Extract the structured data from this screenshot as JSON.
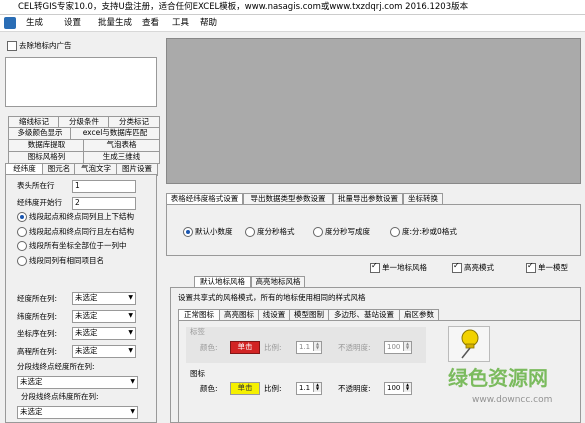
{
  "title": "CEL转GIS专家10.0，支持U盘注册，适合任何EXCEL模板，www.nasagis.com或www.txzdqrj.com 2016.1203版本",
  "menu": [
    "生成",
    "设置",
    "批量生成",
    "查看",
    "工具",
    "帮助"
  ],
  "remove_ads": "去除地标内广告",
  "left_tabs_row1": [
    "缩线标记",
    "分级条件",
    "分类标记"
  ],
  "left_tabs_row2": [
    "多级颜色显示",
    "excel与数据库匹配"
  ],
  "left_tabs_row3": [
    "数据库提取",
    "气泡表格"
  ],
  "left_tabs_row4": [
    "图标风格列",
    "生成三维线"
  ],
  "left_tabs_row5": [
    "经纬度",
    "图元名",
    "气泡文字",
    "图片设置"
  ],
  "header_row_label": "表头所在行",
  "header_row_value": "1",
  "start_row_label": "经纬度开始行",
  "start_row_value": "2",
  "structure_options": [
    "线段起点和终点同列且上下结构",
    "线段起点和终点同行且左右结构",
    "线段所有坐标全部位于一列中",
    "线段同列有相同项目名"
  ],
  "structure_selected": 0,
  "column_fields": [
    {
      "label": "经度所在列:",
      "value": "未选定"
    },
    {
      "label": "纬度所在列:",
      "value": "未选定"
    },
    {
      "label": "坐标序在列:",
      "value": "未选定"
    },
    {
      "label": "高程所在列:",
      "value": "未选定"
    }
  ],
  "segment_lon_label": "分段线终点经度所在列:",
  "segment_lon_value": "未选定",
  "segment_lat_label": "分段线终点纬度所在列:",
  "segment_lat_value": "未选定",
  "format_tabs": [
    "表格经纬度格式设置",
    "导出数据类型参数设置",
    "批量导出参数设置",
    "坐标转换"
  ],
  "format_options": [
    "默认小数度",
    "度分秒格式",
    "度分秒写成度",
    "度:分:秒或0格式"
  ],
  "format_selected": 0,
  "checkbox_single_style": "单一地标风格",
  "checkbox_high_mode": "高亮模式",
  "checkbox_single_model": "单一模型",
  "style_tabs": [
    "默认地标风格",
    "高亮地标风格"
  ],
  "style_description": "设置共享式的风格模式，所有的地标使用相同的样式风格",
  "inner_tabs": [
    "正常图标",
    "高亮图标",
    "线设置",
    "模型图制",
    "多边形、基站设置",
    "扇区参数"
  ],
  "label_group": "标签",
  "icon_group": "图标",
  "color_label": "颜色:",
  "scale_label": "比例:",
  "opacity_label": "不透明度:",
  "color_button": "单击",
  "scale_value": "1.1",
  "opacity_value": "100",
  "watermark_cn": "绿色资源网",
  "watermark_url": "www.downcc.com",
  "colors": {
    "canvas": "#aaaaaa",
    "red_btn": "#d01010",
    "yellow_btn": "#f5f000",
    "watermark": "#5fae3a"
  }
}
